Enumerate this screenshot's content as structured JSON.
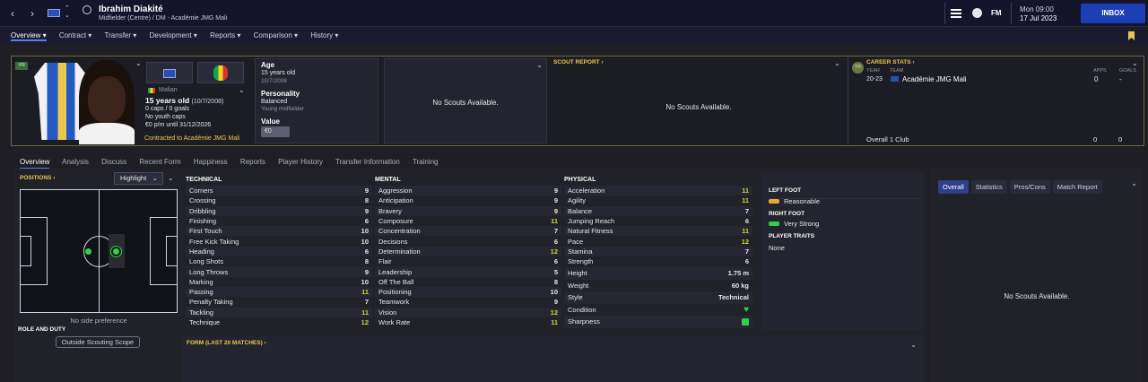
{
  "header": {
    "player_name": "Ibrahim Diakité",
    "player_sub": "Midfielder (Centre) / DM - Académie JMG Mali",
    "fm_label": "FM",
    "time": "Mon 09:00",
    "date": "17 Jul 2023",
    "inbox_label": "INBOX"
  },
  "menu": [
    "Overview",
    "Contract",
    "Transfer",
    "Development",
    "Reports",
    "Comparison",
    "History"
  ],
  "profile": {
    "yr_badge": "YR",
    "nationality": "Malian",
    "age_line": "15 years old",
    "dob_paren": "(10/7/2008)",
    "caps": "0 caps / 0 goals",
    "youth_caps": "No youth caps",
    "wage": "€0 p/m until 31/12/2026",
    "contracted": "Contracted to Académie JMG Mali"
  },
  "details": {
    "age_label": "Age",
    "age_value": "15 years old",
    "age_dob": "10/7/2008",
    "personality_label": "Personality",
    "personality_value": "Balanced",
    "personality_sub": "Young midfielder",
    "value_label": "Value",
    "value_value": "€0"
  },
  "no_scouts": "No Scouts Available.",
  "scout_report": {
    "title": "SCOUT REPORT ›",
    "body": "No Scouts Available."
  },
  "career": {
    "title": "CAREER STATS ›",
    "yr_badge": "YR",
    "col_year": "YEAR",
    "col_team": "TEAM",
    "col_apps": "APPS",
    "col_goals": "GOALS",
    "row_year": "20-23",
    "row_team": "Académie JMG Mali",
    "row_apps": "0",
    "row_goals": "-",
    "total_label": "Overall 1 Club",
    "total_apps": "0",
    "total_goals": "0"
  },
  "subtabs": [
    "Overview",
    "Analysis",
    "Discuss",
    "Recent Form",
    "Happiness",
    "Reports",
    "Player History",
    "Transfer Information",
    "Training"
  ],
  "positions": {
    "title": "POSITIONS ›",
    "dropdown": "Highlight",
    "side_pref": "No side preference",
    "role_title": "ROLE AND DUTY",
    "scope_btn": "Outside Scouting Scope"
  },
  "technical": {
    "title": "TECHNICAL",
    "rows": [
      {
        "n": "Corners",
        "v": "9"
      },
      {
        "n": "Crossing",
        "v": "8"
      },
      {
        "n": "Dribbling",
        "v": "9"
      },
      {
        "n": "Finishing",
        "v": "6"
      },
      {
        "n": "First Touch",
        "v": "10"
      },
      {
        "n": "Free Kick Taking",
        "v": "10"
      },
      {
        "n": "Heading",
        "v": "6"
      },
      {
        "n": "Long Shots",
        "v": "8"
      },
      {
        "n": "Long Throws",
        "v": "9"
      },
      {
        "n": "Marking",
        "v": "10"
      },
      {
        "n": "Passing",
        "v": "11"
      },
      {
        "n": "Penalty Taking",
        "v": "7"
      },
      {
        "n": "Tackling",
        "v": "11"
      },
      {
        "n": "Technique",
        "v": "12"
      }
    ]
  },
  "mental": {
    "title": "MENTAL",
    "rows": [
      {
        "n": "Aggression",
        "v": "9"
      },
      {
        "n": "Anticipation",
        "v": "9"
      },
      {
        "n": "Bravery",
        "v": "9"
      },
      {
        "n": "Composure",
        "v": "11"
      },
      {
        "n": "Concentration",
        "v": "7"
      },
      {
        "n": "Decisions",
        "v": "6"
      },
      {
        "n": "Determination",
        "v": "12"
      },
      {
        "n": "Flair",
        "v": "6"
      },
      {
        "n": "Leadership",
        "v": "5"
      },
      {
        "n": "Off The Ball",
        "v": "8"
      },
      {
        "n": "Positioning",
        "v": "10"
      },
      {
        "n": "Teamwork",
        "v": "9"
      },
      {
        "n": "Vision",
        "v": "12"
      },
      {
        "n": "Work Rate",
        "v": "11"
      }
    ]
  },
  "physical": {
    "title": "PHYSICAL",
    "rows": [
      {
        "n": "Acceleration",
        "v": "11"
      },
      {
        "n": "Agility",
        "v": "11"
      },
      {
        "n": "Balance",
        "v": "7"
      },
      {
        "n": "Jumping Reach",
        "v": "6"
      },
      {
        "n": "Natural Fitness",
        "v": "11"
      },
      {
        "n": "Pace",
        "v": "12"
      },
      {
        "n": "Stamina",
        "v": "7"
      },
      {
        "n": "Strength",
        "v": "6"
      }
    ],
    "height_label": "Height",
    "height_value": "1.75 m",
    "weight_label": "Weight",
    "weight_value": "60 kg",
    "style_label": "Style",
    "style_value": "Technical",
    "condition_label": "Condition",
    "sharpness_label": "Sharpness"
  },
  "feet": {
    "left_title": "LEFT FOOT",
    "left_value": "Reasonable",
    "right_title": "RIGHT FOOT",
    "right_value": "Very Strong",
    "traits_title": "PLAYER TRAITS",
    "traits_value": "None"
  },
  "form_title": "FORM (LAST 20 MATCHES) ›",
  "report_tabs": [
    "Overall",
    "Statistics",
    "Pros/Cons",
    "Match Report"
  ],
  "report_body": "No Scouts Available.",
  "colors": {
    "accent": "#5d7cf2",
    "highlight": "#c7d93a",
    "gold": "#e8c94d",
    "green": "#2fd04a"
  }
}
